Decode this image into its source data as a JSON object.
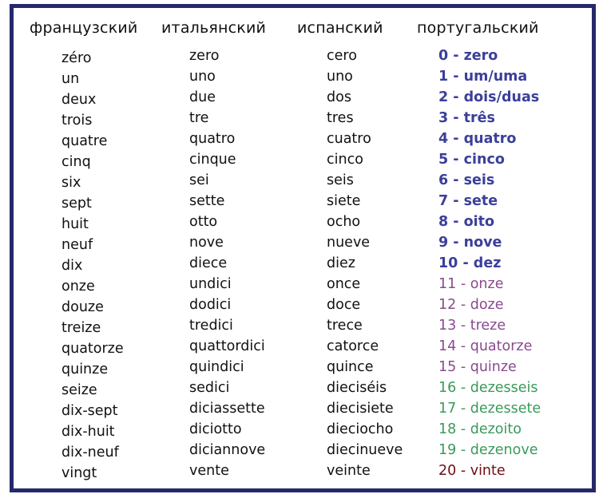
{
  "headers": {
    "french": "французский",
    "italian": "итальянский",
    "spanish": "испанский",
    "portuguese": "португальский"
  },
  "colors": {
    "border": "#25296b",
    "pt_0_10": "#3b3f9a",
    "pt_11_15": "#8a4a8e",
    "pt_16_19": "#3a9a5a",
    "pt_20": "#6e0f16"
  },
  "french": [
    "zéro",
    "un",
    "deux",
    "trois",
    "quatre",
    "cinq",
    "six",
    "sept",
    "huit",
    "neuf",
    "dix",
    "onze",
    "douze",
    "treize",
    "quatorze",
    "quinze",
    "seize",
    "dix-sept",
    "dix-huit",
    "dix-neuf",
    "vingt"
  ],
  "italian": [
    "zero",
    "uno",
    "due",
    "tre",
    "quatro",
    "cinque",
    "sei",
    "sette",
    "otto",
    "nove",
    "diece",
    "undici",
    "dodici",
    "tredici",
    "quattordici",
    "quindici",
    "sedici",
    "diciassette",
    "diciotto",
    "diciannove",
    "vente"
  ],
  "spanish": [
    "cero",
    "uno",
    "dos",
    "tres",
    "cuatro",
    "cinco",
    "seis",
    "siete",
    "ocho",
    "nueve",
    "diez",
    "once",
    "doce",
    "trece",
    "catorce",
    "quince",
    "dieciséis",
    "diecisiete",
    "dieciocho",
    "diecinueve",
    "veinte"
  ],
  "portuguese": [
    {
      "text": "0 - zero",
      "group": "pt_0_10"
    },
    {
      "text": "1 - um/uma",
      "group": "pt_0_10"
    },
    {
      "text": "2 - dois/duas",
      "group": "pt_0_10"
    },
    {
      "text": "3 - três",
      "group": "pt_0_10"
    },
    {
      "text": "4 - quatro",
      "group": "pt_0_10"
    },
    {
      "text": "5 - cinco",
      "group": "pt_0_10"
    },
    {
      "text": "6 - seis",
      "group": "pt_0_10"
    },
    {
      "text": "7 - sete",
      "group": "pt_0_10"
    },
    {
      "text": "8 - oito",
      "group": "pt_0_10"
    },
    {
      "text": "9 - nove",
      "group": "pt_0_10"
    },
    {
      "text": "10 - dez",
      "group": "pt_0_10"
    },
    {
      "text": "11 - onze",
      "group": "pt_11_15"
    },
    {
      "text": "12 - doze",
      "group": "pt_11_15"
    },
    {
      "text": "13 - treze",
      "group": "pt_11_15"
    },
    {
      "text": "14 - quatorze",
      "group": "pt_11_15"
    },
    {
      "text": "15 - quinze",
      "group": "pt_11_15"
    },
    {
      "text": "16 - dezesseis",
      "group": "pt_16_19"
    },
    {
      "text": "17 - dezessete",
      "group": "pt_16_19"
    },
    {
      "text": "18 - dezoito",
      "group": "pt_16_19"
    },
    {
      "text": "19 - dezenove",
      "group": "pt_16_19"
    },
    {
      "text": "20 - vinte",
      "group": "pt_20"
    }
  ]
}
